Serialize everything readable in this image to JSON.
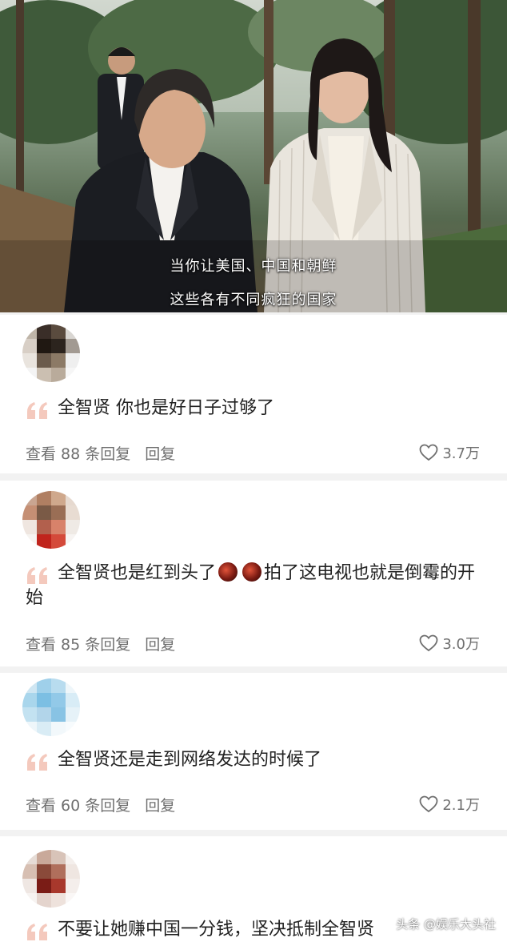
{
  "video": {
    "subtitle_line1": "当你让美国、中国和朝鲜",
    "subtitle_line2": "这些各有不同疯狂的国家"
  },
  "comments": [
    {
      "text": "全智贤 你也是好日子过够了",
      "view_replies": "查看 88 条回复",
      "reply": "回复",
      "likes": "3.7万"
    },
    {
      "text_before_emoji": "全智贤也是红到头了",
      "text_after_emoji": "拍了这电视也就是倒霉的开始",
      "view_replies": "查看 85 条回复",
      "reply": "回复",
      "likes": "3.0万"
    },
    {
      "text": "全智贤还是走到网络发达的时候了",
      "view_replies": "查看 60 条回复",
      "reply": "回复",
      "likes": "2.1万"
    },
    {
      "text": "不要让她赚中国一分钱，坚决抵制全智贤"
    }
  ],
  "watermark": "头条 @娱乐大头社",
  "colors": {
    "quote_icon": "#f4c9bd",
    "text": "#222222",
    "meta": "#6f6f6f",
    "card_bg": "#ffffff",
    "page_bg": "#f2f2f2"
  }
}
